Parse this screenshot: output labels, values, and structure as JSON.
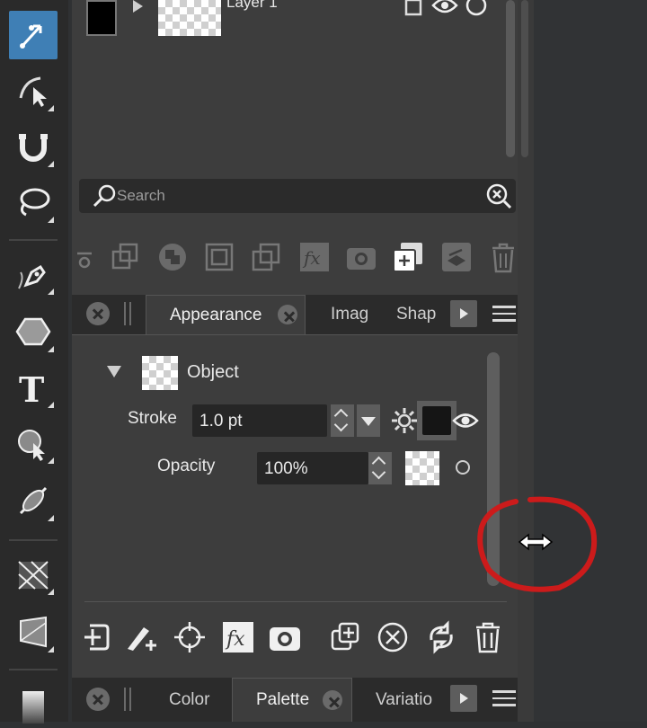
{
  "layers": {
    "layer_name": "Layer 1"
  },
  "search": {
    "placeholder": "Search"
  },
  "appearance_tabs": {
    "items": [
      {
        "label": "Appearance",
        "active": true
      },
      {
        "label": "Imag",
        "active": false
      },
      {
        "label": "Shap",
        "active": false
      }
    ]
  },
  "appearance": {
    "object_label": "Object",
    "stroke_label": "Stroke",
    "stroke_value": "1.0 pt",
    "opacity_label": "Opacity",
    "opacity_value": "100%",
    "stroke_color": "#151515"
  },
  "bottom_tabs": {
    "items": [
      {
        "label": "Color",
        "active": false
      },
      {
        "label": "Palette",
        "active": true
      },
      {
        "label": "Variatio",
        "active": false
      }
    ]
  },
  "colors": {
    "accent": "#3f7fb5",
    "annotation": "#cc1b1b"
  },
  "icons": {
    "toolbar": [
      "node-select-icon",
      "direct-select-icon",
      "magnetic-icon",
      "lasso-icon",
      "pen-icon",
      "polygon-icon",
      "text-icon",
      "shape-builder-icon",
      "knife-icon",
      "mesh-icon",
      "perspective-icon",
      "gradient-icon"
    ],
    "actions": [
      "link-icon",
      "duplicate-icon",
      "combine-icon",
      "group-icon",
      "arrange-icon",
      "fx-icon",
      "camera-icon",
      "new-layer-icon",
      "layer-stack-icon",
      "trash-icon"
    ],
    "bottom_actions": [
      "add-attribute-icon",
      "add-stroke-icon",
      "target-icon",
      "fx-icon",
      "camera-icon",
      "duplicate-icon",
      "clear-icon",
      "refresh-icon",
      "trash-icon"
    ]
  }
}
